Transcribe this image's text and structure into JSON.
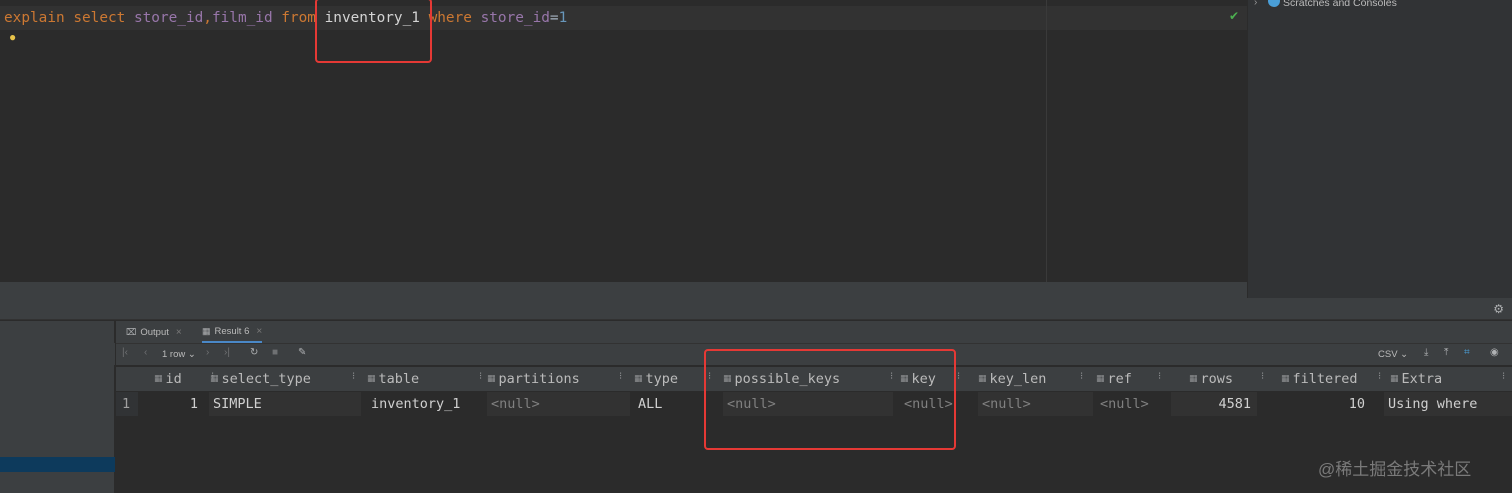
{
  "editor": {
    "sql_tokens": [
      {
        "text": "explain",
        "cls": "kw"
      },
      {
        "text": " ",
        "cls": "plain"
      },
      {
        "text": "select",
        "cls": "kw"
      },
      {
        "text": " ",
        "cls": "plain"
      },
      {
        "text": "store_id",
        "cls": "id"
      },
      {
        "text": ",",
        "cls": "kw"
      },
      {
        "text": "film_id",
        "cls": "id"
      },
      {
        "text": " ",
        "cls": "plain"
      },
      {
        "text": "from",
        "cls": "kw"
      },
      {
        "text": " ",
        "cls": "plain"
      },
      {
        "text": "inventory_1",
        "cls": "tbl"
      },
      {
        "text": " ",
        "cls": "plain"
      },
      {
        "text": "where",
        "cls": "kw"
      },
      {
        "text": " ",
        "cls": "plain"
      },
      {
        "text": "store_id",
        "cls": "id"
      },
      {
        "text": "=",
        "cls": "plain"
      },
      {
        "text": "1",
        "cls": "num"
      }
    ]
  },
  "project": {
    "scratches_label": "Scratches and Consoles"
  },
  "result": {
    "tabs": [
      {
        "label": "Output",
        "icon": "output-icon"
      },
      {
        "label": "Result 6",
        "icon": "table-icon",
        "active": true
      }
    ],
    "row_count": "1 row",
    "export_format": "CSV",
    "columns": [
      "id",
      "select_type",
      "table",
      "partitions",
      "type",
      "possible_keys",
      "key",
      "key_len",
      "ref",
      "rows",
      "filtered",
      "Extra"
    ],
    "row_number": "1",
    "row": [
      "1",
      "SIMPLE",
      "inventory_1",
      "<null>",
      "ALL",
      "<null>",
      "<null>",
      "<null>",
      "<null>",
      "4581",
      "10",
      "Using where"
    ]
  },
  "watermark": "@稀土掘金技术社区",
  "colors": {
    "highlight_box": "#e53935",
    "keyword": "#cc7832",
    "identifier": "#9876aa",
    "number": "#6897bb"
  }
}
